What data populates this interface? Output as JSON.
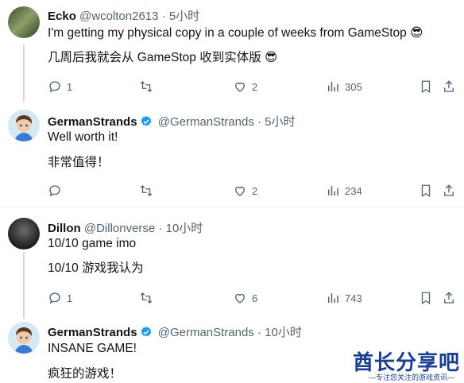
{
  "colors": {
    "text": "#0f1419",
    "secondary": "#536471",
    "verified": "#1d9bf0",
    "line": "#cfd9de",
    "watermark": "#1b3f8f"
  },
  "tweets": [
    {
      "name": "Ecko",
      "handle": "@wcolton2613",
      "sep": "·",
      "time": "5小时",
      "lines": [
        "I'm getting my physical copy in a couple of weeks from GameStop 😎",
        "几周后我就会从 GameStop 收到实体版 😎"
      ],
      "replies": "1",
      "retweets": "",
      "likes": "2",
      "views": "305",
      "verified": false
    },
    {
      "name": "GermanStrands",
      "handle": "@GermanStrands",
      "sep": "·",
      "time": "5小时",
      "lines": [
        "Well worth it!",
        "非常值得！"
      ],
      "replies": "",
      "retweets": "",
      "likes": "2",
      "views": "234",
      "verified": true
    },
    {
      "name": "Dillon",
      "handle": "@Dillonverse",
      "sep": "·",
      "time": "10小时",
      "lines": [
        "10/10 game imo",
        "10/10 游戏我认为"
      ],
      "replies": "1",
      "retweets": "",
      "likes": "6",
      "views": "743",
      "verified": false
    },
    {
      "name": "GermanStrands",
      "handle": "@GermanStrands",
      "sep": "·",
      "time": "10小时",
      "lines": [
        "INSANE GAME!",
        "疯狂的游戏！"
      ],
      "verified": true
    }
  ],
  "watermark": {
    "title": "酋长分享吧",
    "subtitle": "—专注您关注的游戏资讯—"
  }
}
